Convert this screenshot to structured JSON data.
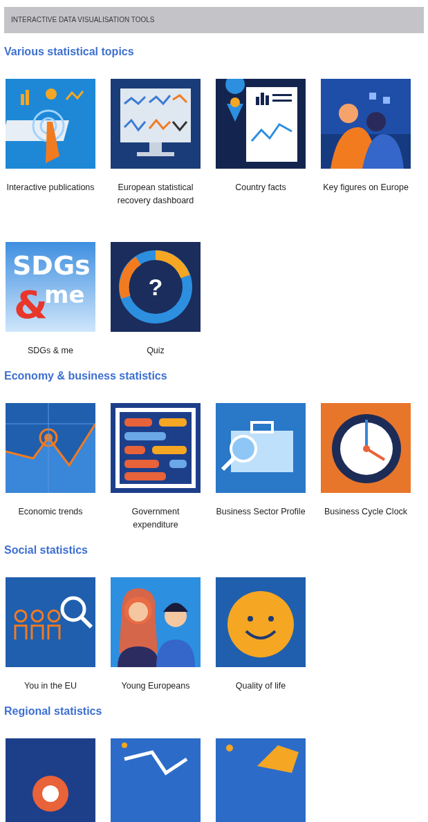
{
  "header": {
    "title": "INTERACTIVE DATA VISUALISATION TOOLS"
  },
  "sections": [
    {
      "title": "Various statistical topics",
      "tools": [
        {
          "label": "Interactive publications",
          "kind": "publications"
        },
        {
          "label": "European statistical recovery dashboard",
          "kind": "dashboard"
        },
        {
          "label": "Country facts",
          "kind": "country"
        },
        {
          "label": "Key figures on Europe",
          "kind": "keyfigures"
        },
        {
          "label": "SDGs & me",
          "kind": "sdgs",
          "art_text": [
            "SDGs",
            "&",
            "me"
          ]
        },
        {
          "label": "Quiz",
          "kind": "quiz",
          "art_text": [
            "?"
          ]
        }
      ]
    },
    {
      "title": "Economy & business statistics",
      "tools": [
        {
          "label": "Economic trends",
          "kind": "trends"
        },
        {
          "label": "Government expenditure",
          "kind": "abacus"
        },
        {
          "label": "Business Sector Profile",
          "kind": "briefcase"
        },
        {
          "label": "Business Cycle Clock",
          "kind": "clock"
        }
      ]
    },
    {
      "title": "Social statistics",
      "tools": [
        {
          "label": "You in the EU",
          "kind": "people"
        },
        {
          "label": "Young Europeans",
          "kind": "young"
        },
        {
          "label": "Quality of life",
          "kind": "smiley"
        }
      ]
    },
    {
      "title": "Regional statistics",
      "tools": [
        {
          "kind": "region1"
        },
        {
          "kind": "region2"
        },
        {
          "kind": "region3"
        }
      ]
    }
  ]
}
